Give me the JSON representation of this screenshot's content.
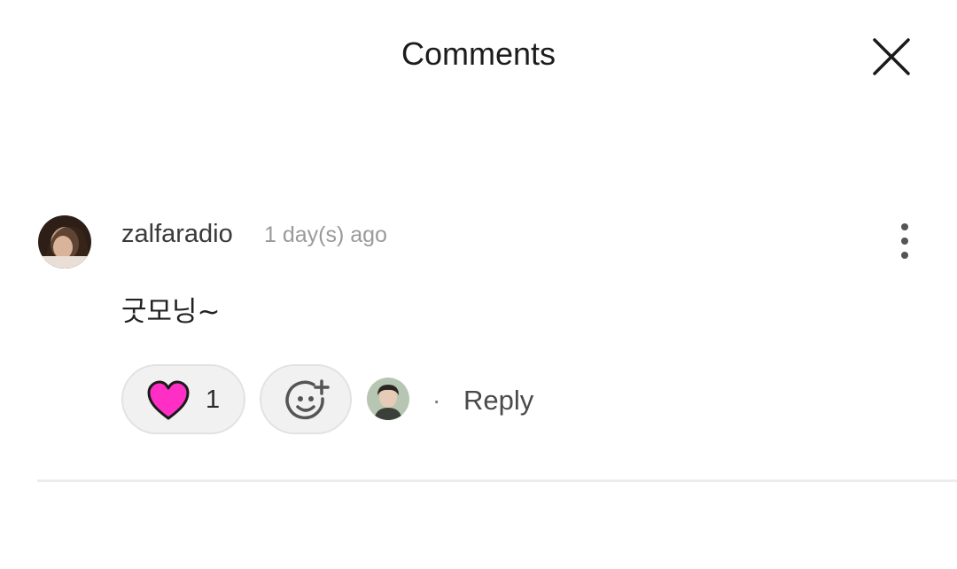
{
  "header": {
    "title": "Comments",
    "close_icon": "close-icon"
  },
  "comment": {
    "username": "zalfaradio",
    "timestamp": "1 day(s) ago",
    "text": "굿모닝~",
    "more_icon": "vertical-dots-icon"
  },
  "reactions": {
    "like_icon": "heart-icon",
    "like_color": "#ff2ec4",
    "like_count": "1",
    "add_reaction_icon": "add-emoji-icon"
  },
  "actions": {
    "separator": "·",
    "reply_label": "Reply"
  }
}
